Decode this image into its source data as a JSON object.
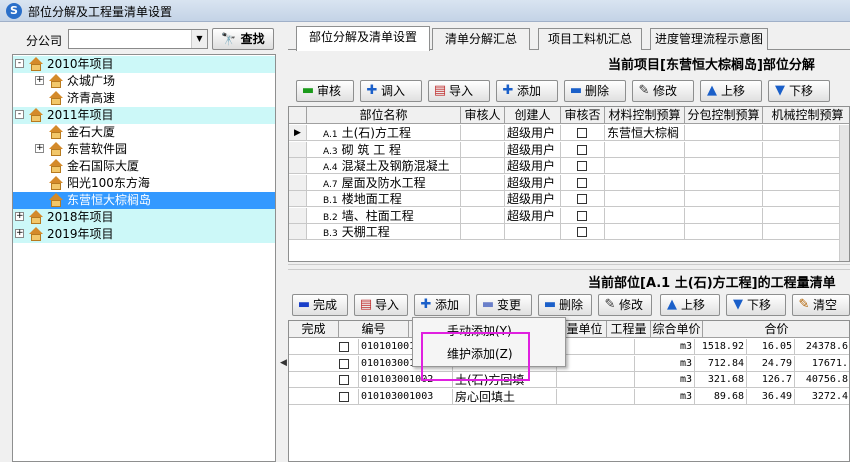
{
  "window": {
    "title": "部位分解及工程量清单设置",
    "icon": "app-logo-icon"
  },
  "filter": {
    "label": "分公司",
    "combo_value": "",
    "find_button": "查找"
  },
  "tree": [
    {
      "label": "2010年项目",
      "level": 0,
      "toggle": "-",
      "selected": false,
      "header": true
    },
    {
      "label": "众城广场",
      "level": 1,
      "toggle": "+",
      "selected": false,
      "header": false
    },
    {
      "label": "济青高速",
      "level": 1,
      "toggle": "",
      "selected": false,
      "header": false
    },
    {
      "label": "2011年项目",
      "level": 0,
      "toggle": "-",
      "selected": false,
      "header": true
    },
    {
      "label": "金石大厦",
      "level": 1,
      "toggle": "",
      "selected": false,
      "header": false
    },
    {
      "label": "东营软件园",
      "level": 1,
      "toggle": "+",
      "selected": false,
      "header": false
    },
    {
      "label": "金石国际大厦",
      "level": 1,
      "toggle": "",
      "selected": false,
      "header": false
    },
    {
      "label": "阳光100东方海",
      "level": 1,
      "toggle": "",
      "selected": false,
      "header": false
    },
    {
      "label": "东营恒大棕榈岛",
      "level": 1,
      "toggle": "",
      "selected": true,
      "header": false
    },
    {
      "label": "2018年项目",
      "level": 0,
      "toggle": "+",
      "selected": false,
      "header": true
    },
    {
      "label": "2019年项目",
      "level": 0,
      "toggle": "+",
      "selected": false,
      "header": true
    }
  ],
  "tabs": [
    "部位分解及清单设置",
    "清单分解汇总",
    "项目工料机汇总",
    "进度管理流程示意图"
  ],
  "active_tab": 0,
  "top": {
    "heading": "当前项目[东营恒大棕榈岛]部位分解",
    "toolbar": [
      "审核",
      "调入",
      "导入",
      "添加",
      "删除",
      "修改",
      "上移",
      "下移"
    ],
    "columns": [
      "部位名称",
      "审核人",
      "创建人",
      "审核否",
      "材料控制预算",
      "分包控制预算",
      "机械控制预算"
    ],
    "rows": [
      {
        "code": "A.1",
        "name": "土(石)方工程",
        "creator": "超级用户",
        "budget": "东营恒大棕榈",
        "current": true
      },
      {
        "code": "A.3",
        "name": "砌 筑 工 程",
        "creator": "超级用户",
        "budget": "",
        "current": false
      },
      {
        "code": "A.4",
        "name": "混凝土及钢筋混凝土",
        "creator": "超级用户",
        "budget": "",
        "current": false
      },
      {
        "code": "A.7",
        "name": "屋面及防水工程",
        "creator": "超级用户",
        "budget": "",
        "current": false
      },
      {
        "code": "B.1",
        "name": "楼地面工程",
        "creator": "超级用户",
        "budget": "",
        "current": false
      },
      {
        "code": "B.2",
        "name": "墙、柱面工程",
        "creator": "超级用户",
        "budget": "",
        "current": false
      },
      {
        "code": "B.3",
        "name": "天棚工程",
        "creator": "",
        "budget": "",
        "current": false
      }
    ]
  },
  "bottom": {
    "heading": "当前部位[A.1  土(石)方工程]的工程量清单",
    "toolbar": [
      "完成",
      "导入",
      "添加",
      "变更",
      "删除",
      "修改",
      "上移",
      "下移",
      "清空"
    ],
    "columns": [
      "完成",
      "编号",
      "",
      "项目描述",
      "计量单位",
      "工程量",
      "综合单价",
      "合价"
    ],
    "rows": [
      {
        "code": "010101001",
        "name": "",
        "unit": "m3",
        "qty": "1518.92",
        "price": "16.05",
        "total": "24378.6"
      },
      {
        "code": "010103001",
        "name": "",
        "unit": "m3",
        "qty": "712.84",
        "price": "24.79",
        "total": "17671."
      },
      {
        "code": "010103001002",
        "name": "土(石)方回填",
        "unit": "m3",
        "qty": "321.68",
        "price": "126.7",
        "total": "40756.8"
      },
      {
        "code": "010103001003",
        "name": "房心回填土",
        "unit": "m3",
        "qty": "89.68",
        "price": "36.49",
        "total": "3272.4"
      }
    ]
  },
  "context_menu": [
    "手动添加(Y)",
    "维护添加(Z)"
  ]
}
